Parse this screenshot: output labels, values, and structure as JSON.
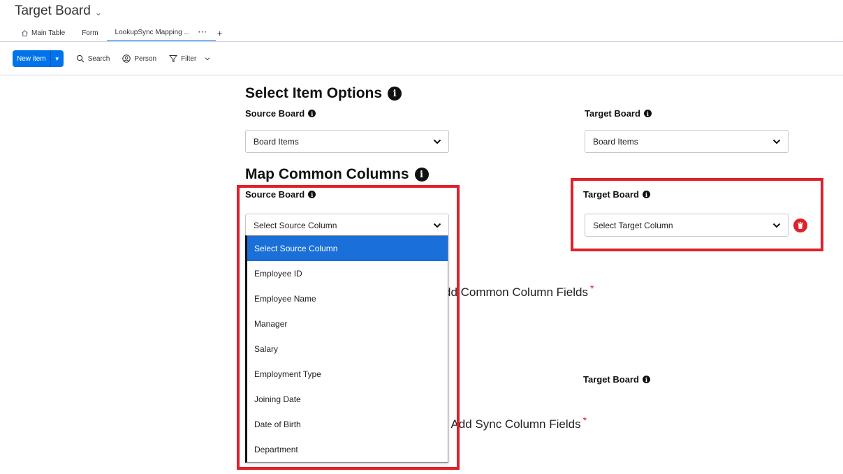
{
  "header": {
    "title": "Target Board",
    "tabs": [
      {
        "label": "Main Table"
      },
      {
        "label": "Form"
      },
      {
        "label": "LookupSync Mapping ..."
      }
    ],
    "tab_more": "···",
    "tab_add": "+"
  },
  "toolbar": {
    "new_item_label": "New item",
    "search_label": "Search",
    "person_label": "Person",
    "filter_label": "Filter"
  },
  "select_item_options": {
    "heading": "Select Item Options",
    "source_label": "Source Board",
    "target_label": "Target Board",
    "source_value": "Board Items",
    "target_value": "Board Items"
  },
  "map_common_columns": {
    "heading": "Map Common Columns",
    "source_label": "Source Board",
    "target_label": "Target Board",
    "source_value": "Select Source Column",
    "target_value": "Select Target Column",
    "add_common_text": "dd Common Column Fields",
    "target_label_2": "Target Board",
    "add_sync_text": "- Add Sync Column Fields",
    "required_mark": "*"
  },
  "dropdown": {
    "options": [
      "Select Source Column",
      "Employee ID",
      "Employee Name",
      "Manager",
      "Salary",
      "Employment Type",
      "Joining Date",
      "Date of Birth",
      "Department"
    ],
    "selected_index": 0
  },
  "colors": {
    "accent": "#0073ea",
    "highlight": "#e0202a",
    "selected_option": "#1a6fd8"
  }
}
